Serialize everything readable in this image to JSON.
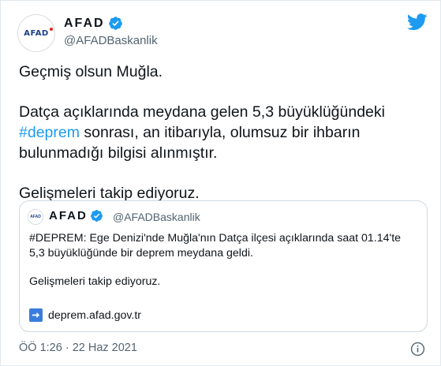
{
  "author": {
    "display_name": "AFAD",
    "handle": "@AFADBaskanlik",
    "avatar_text": "AFAD"
  },
  "tweet": {
    "line1": "Geçmiş olsun Muğla.",
    "para2_before": "Datça açıklarında meydana gelen 5,3 büyüklüğündeki",
    "hashtag": "#deprem",
    "para2_after": " sonrası, an itibarıyla, olumsuz bir ihbarın bulunmadığı bilgisi alınmıştır.",
    "para3": "Gelişmeleri takip ediyoruz."
  },
  "quoted": {
    "display_name": "AFAD",
    "handle": "@AFADBaskanlik",
    "avatar_text": "AFAD",
    "text1": "#DEPREM: Ege Denizi'nde Muğla'nın Datça ilçesi açıklarında saat 01.14'te 5,3 büyüklüğünde bir deprem meydana geldi.",
    "text2": "Gelişmeleri takip ediyoruz.",
    "link": "deprem.afad.gov.tr",
    "link_icon": "arrow-right-icon"
  },
  "footer": {
    "timestamp": "ÖÖ 1:26 · 22 Haz 2021",
    "info_icon": "info-icon"
  },
  "colors": {
    "accent": "#1d9bf0",
    "text": "#0f1419",
    "secondary": "#536471"
  }
}
